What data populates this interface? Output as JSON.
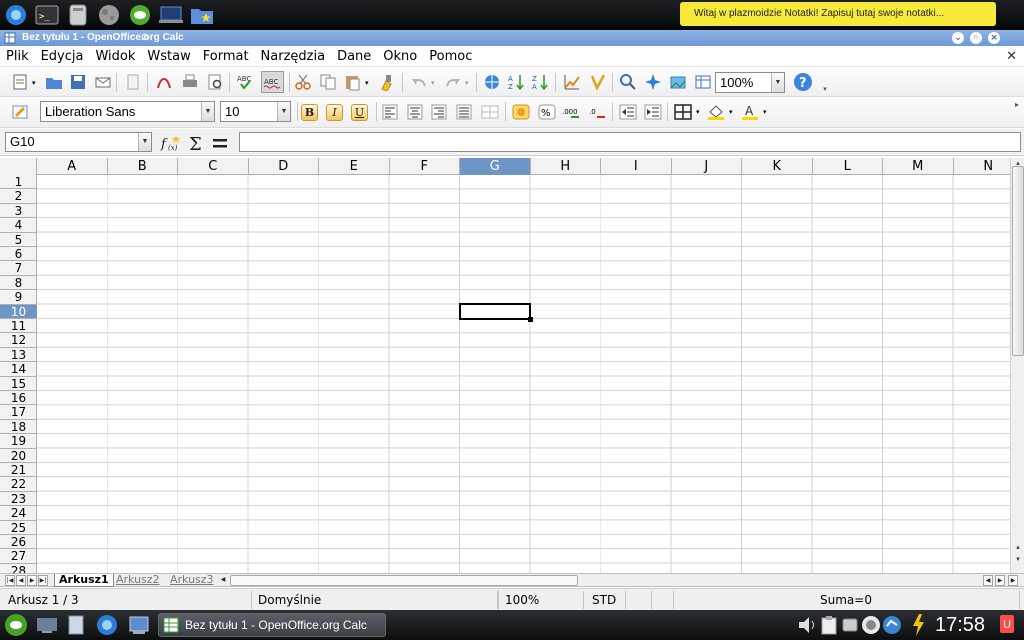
{
  "topbar": {
    "launchers": [
      "kde-menu-icon",
      "terminal-icon",
      "disk-icon",
      "moon-icon",
      "opensuse-icon",
      "laptop-icon",
      "folder-star-icon"
    ],
    "note_text": "Witaj w plazmoidzie Notatki! Zapisuj tutaj swoje notatki..."
  },
  "window": {
    "title": "Bez tytułu 1 - OpenOffice.org Calc"
  },
  "menu": {
    "items": [
      "Plik",
      "Edycja",
      "Widok",
      "Wstaw",
      "Format",
      "Narzędzia",
      "Dane",
      "Okno",
      "Pomoc"
    ]
  },
  "toolbar": {
    "zoom": "100%"
  },
  "format_bar": {
    "font_name": "Liberation Sans",
    "font_size": "10",
    "bold_label": "B",
    "italic_label": "I",
    "underline_label": "U"
  },
  "formula_bar": {
    "cell_ref": "G10",
    "content": ""
  },
  "grid": {
    "columns": [
      "A",
      "B",
      "C",
      "D",
      "E",
      "F",
      "G",
      "H",
      "I",
      "J",
      "K",
      "L",
      "M",
      "N"
    ],
    "rows": [
      "1",
      "2",
      "3",
      "4",
      "5",
      "6",
      "7",
      "8",
      "9",
      "10",
      "11",
      "12",
      "13",
      "14",
      "15",
      "16",
      "17",
      "18",
      "19",
      "20",
      "21",
      "22",
      "23",
      "24",
      "25",
      "26",
      "27",
      "28"
    ],
    "selected_column": "G",
    "selected_row": "10"
  },
  "sheets": {
    "tabs": [
      "Arkusz1",
      "Arkusz2",
      "Arkusz3"
    ],
    "active": "Arkusz1"
  },
  "status": {
    "sheet": "Arkusz 1 / 3",
    "page_style": "Domyślnie",
    "zoom": "100%",
    "mode": "STD",
    "sum": "Suma=0"
  },
  "taskbar": {
    "task_label": "Bez tytułu 1 - OpenOffice.org Calc",
    "clock": "17:58"
  },
  "colors": {
    "header_selected": "#6f95c6",
    "titlebar": "#7aa2da",
    "note_bg": "#f7ea3a"
  }
}
